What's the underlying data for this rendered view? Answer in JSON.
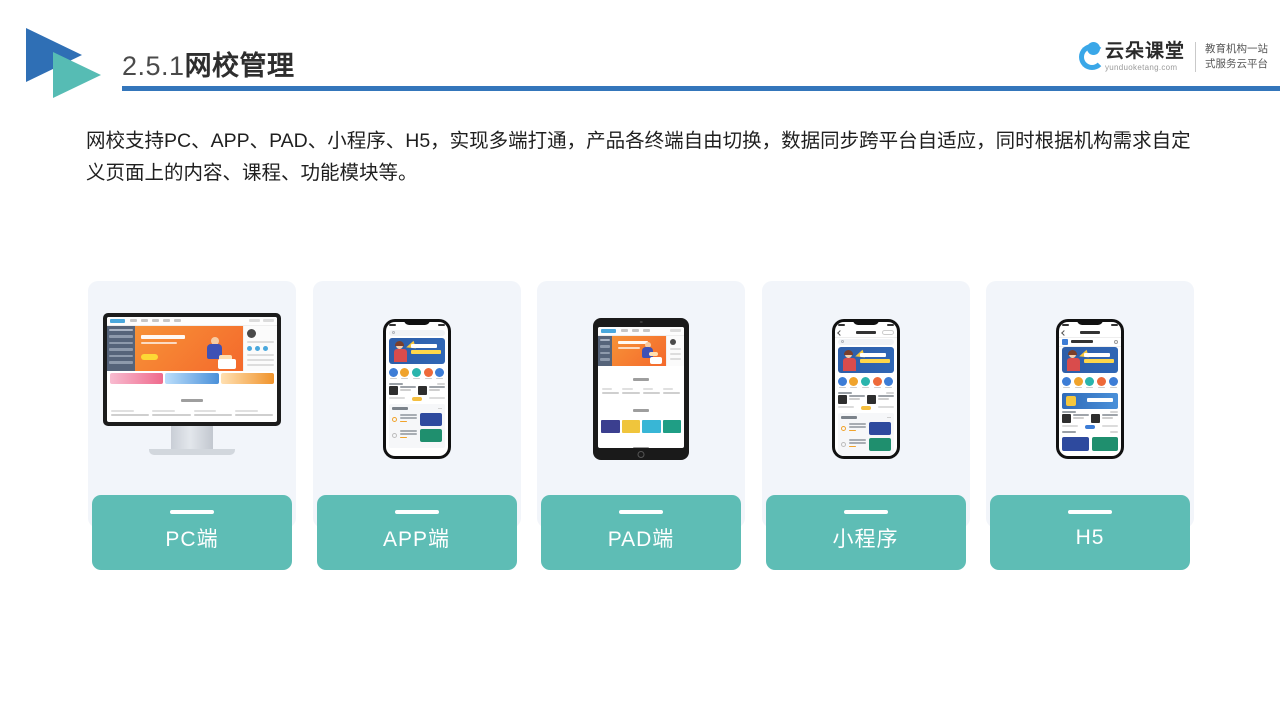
{
  "header": {
    "section_number": "2.5.1",
    "section_title": "网校管理",
    "logo_icon": "double-triangle-play-icon",
    "rule_color": "#3476bb"
  },
  "brand": {
    "cloud_icon": "cloud-icon",
    "name": "云朵课堂",
    "url": "yunduoketang.com",
    "tagline_line1": "教育机构一站",
    "tagline_line2": "式服务云平台",
    "accent_color": "#3aa7e8"
  },
  "content": {
    "paragraph": "网校支持PC、APP、PAD、小程序、H5，实现多端打通，产品各终端自由切换，数据同步跨平台自适应，同时根据机构需求自定义页面上的内容、课程、功能模块等。"
  },
  "cards": {
    "label_color": "#5ebdb5",
    "background_color": "#f2f5fa",
    "items": [
      {
        "label": "PC端",
        "device": "desktop-monitor-icon"
      },
      {
        "label": "APP端",
        "device": "smartphone-icon"
      },
      {
        "label": "PAD端",
        "device": "tablet-icon"
      },
      {
        "label": "小程序",
        "device": "smartphone-miniprogram-icon"
      },
      {
        "label": "H5",
        "device": "smartphone-browser-icon"
      }
    ]
  }
}
